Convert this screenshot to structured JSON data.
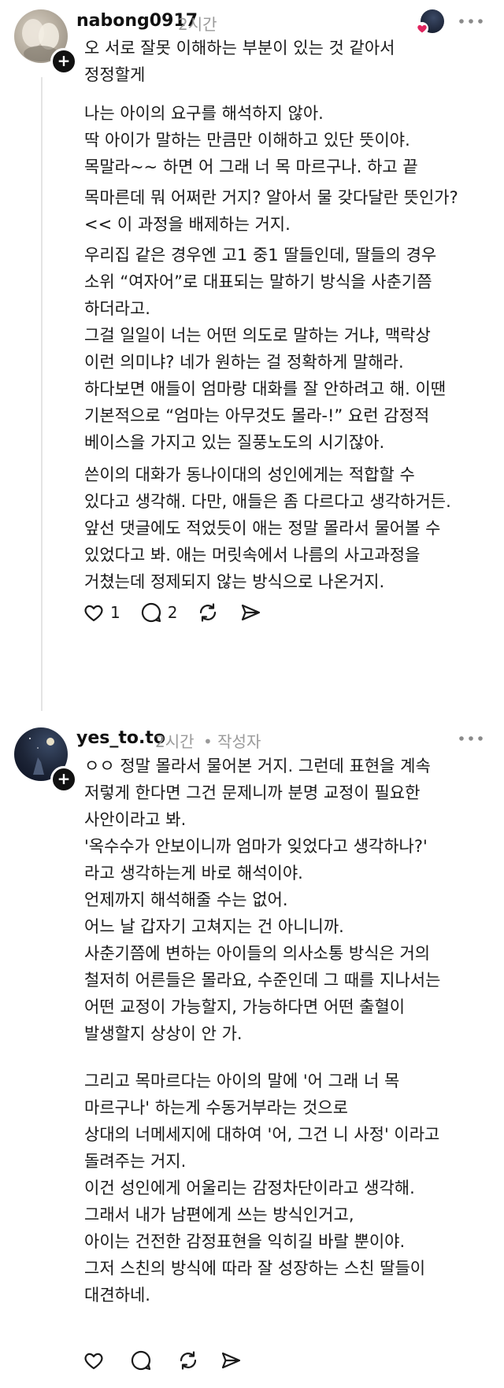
{
  "comments": [
    {
      "username": "nabong0917",
      "time": "2시간",
      "author_tag": "",
      "paragraphs": [
        "오 서로 잘못 이해하는 부분이 있는 것 같아서\n정정할게",
        "나는 아이의 요구를 해석하지 않아.\n딱 아이가 말하는 만큼만 이해하고 있단 뜻이야.\n목말라~~ 하면 어 그래 너 목 마르구나. 하고 끝",
        "목마른데 뭐 어쩌란 거지? 알아서 물 갖다달란 뜻인가?\n<< 이 과정을 배제하는 거지.",
        "우리집 같은 경우엔 고1 중1 딸들인데, 딸들의 경우\n소위 “여자어”로 대표되는 말하기 방식을 사춘기쯤\n하더라고.\n그걸 일일이 너는 어떤 의도로 말하는 거냐, 맥락상\n이런 의미냐? 네가 원하는 걸 정확하게 말해라.\n하다보면 애들이 엄마랑 대화를 잘 안하려고 해. 이땐\n기본적으로 “엄마는 아무것도 몰라-!” 요런 감정적\n베이스을 가지고 있는 질풍노도의 시기잖아.",
        "쓴이의 대화가 동나이대의 성인에게는 적합할 수\n있다고 생각해. 다만, 애들은 좀 다르다고 생각하거든.\n앞선 댓글에도 적었듯이 애는 정말 몰라서 물어볼 수\n있었다고 봐. 애는 머릿속에서 나름의 사고과정을\n거쳤는데 정제되지 않는 방식으로 나온거지."
      ],
      "like_count": "1",
      "reply_count": "2"
    },
    {
      "username": "yes_to.to",
      "time": "2시간",
      "author_tag": "• 작성자",
      "paragraphs": [
        "ㅇㅇ 정말 몰라서 물어본 거지. 그런데 표현을 계속\n저렇게 한다면 그건 문제니까 분명 교정이 필요한\n사안이라고 봐.\n'옥수수가 안보이니까 엄마가 잊었다고 생각하나?'\n라고 생각하는게 바로 해석이야.\n언제까지 해석해줄 수는 없어.\n어느 날 갑자기 고쳐지는 건 아니니까.\n사춘기쯤에 변하는 아이들의 의사소통 방식은 거의\n철저히 어른들은 몰라요, 수준인데 그 때를 지나서는\n어떤 교정이 가능할지, 가능하다면 어떤 출혈이\n발생할지 상상이 안 가.",
        "그리고 목마르다는 아이의 말에 '어 그래 너 목\n마르구나' 하는게 수동거부라는 것으로\n상대의 너메세지에 대하여 '어, 그건 니 사정' 이라고\n돌려주는 거지.\n이건 성인에게 어울리는 감정차단이라고 생각해.\n그래서 내가 남편에게 쓰는 방식인거고,\n아이는 건전한 감정표현을 익히길 바랄 뿐이야.\n그저 스친의 방식에 따라 잘 성장하는 스친 딸들이\n대견하네."
      ],
      "like_count": "",
      "reply_count": ""
    }
  ],
  "icons": {
    "more": "more-horizontal-icon",
    "like": "heart-icon",
    "reply": "comment-icon",
    "repost": "repost-icon",
    "share": "send-icon",
    "follow": "plus-icon"
  },
  "colors": {
    "text": "#1a1a1a",
    "meta": "#9a9a9a",
    "thread_line": "#e4e4e4",
    "heart": "#e0245e"
  }
}
